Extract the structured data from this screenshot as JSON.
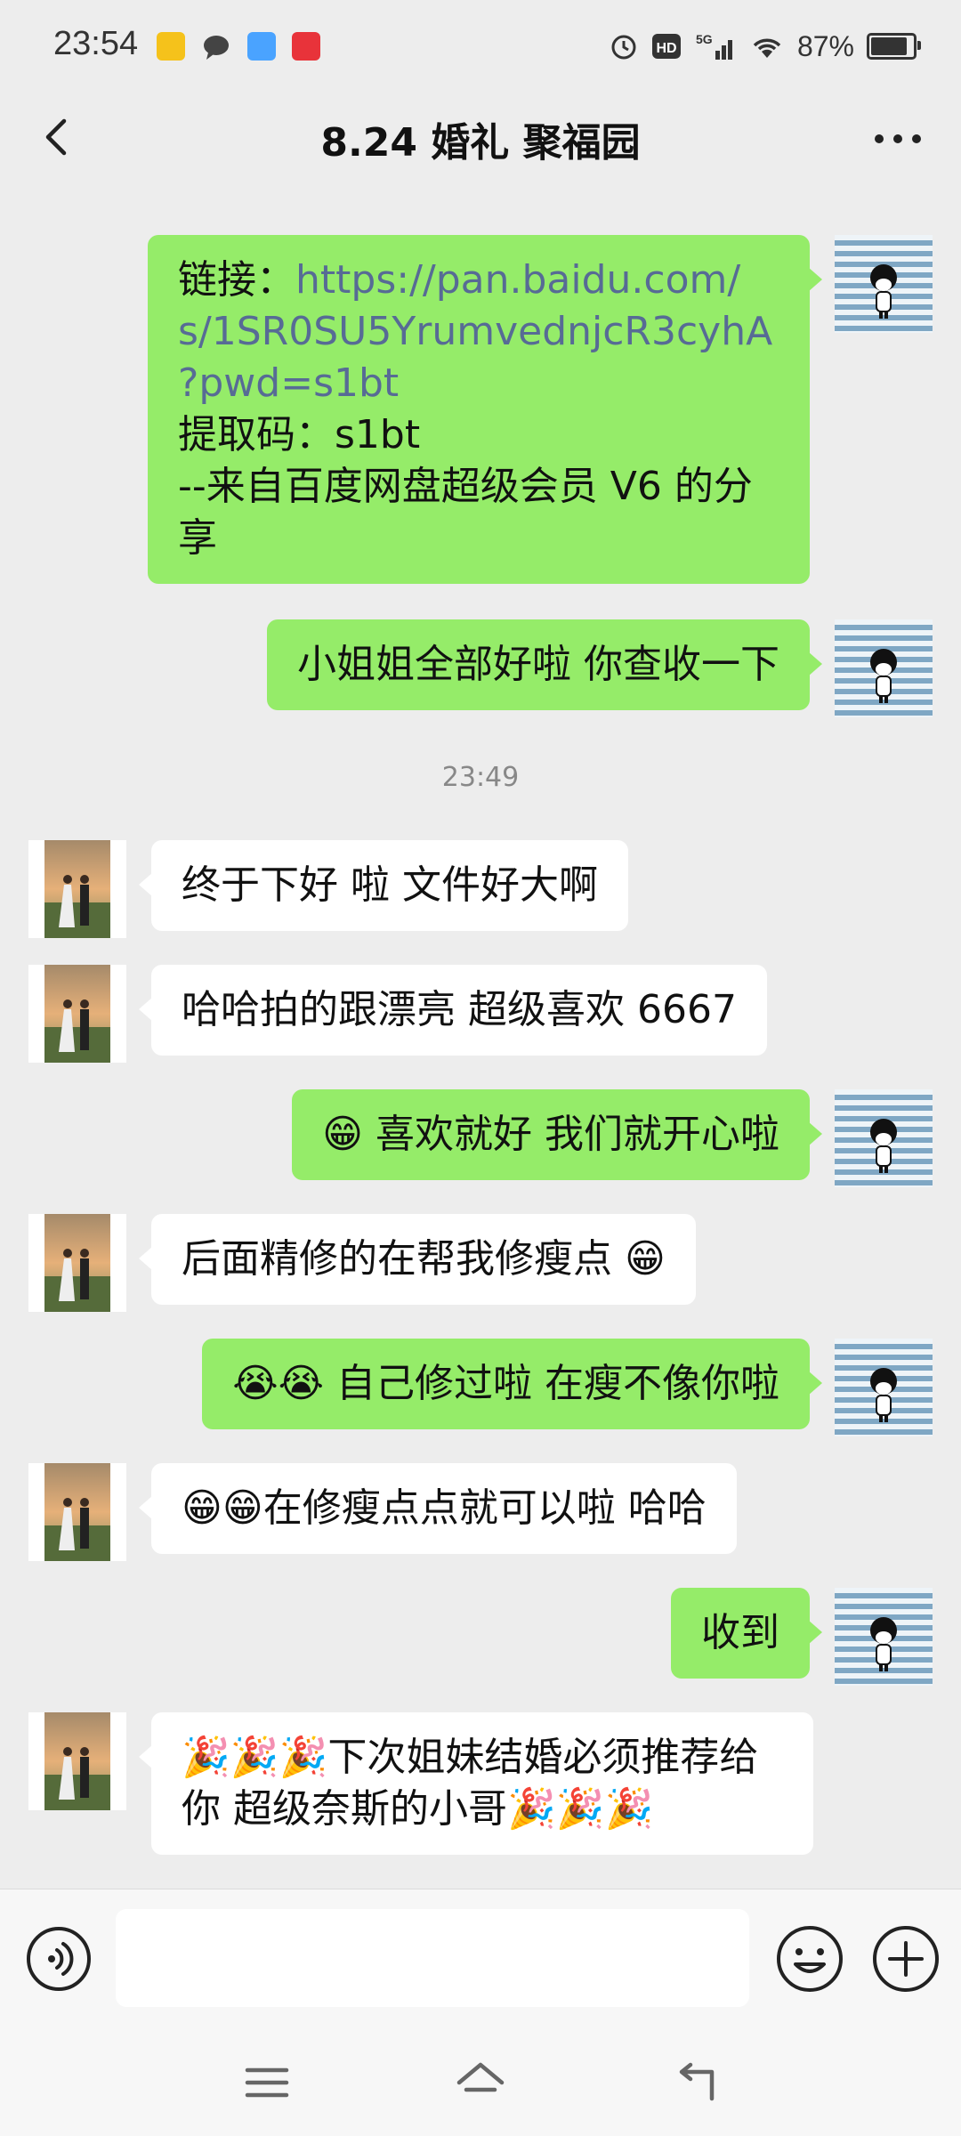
{
  "status_bar": {
    "time": "23:54",
    "battery_text": "87%",
    "battery_level_percent": 87,
    "app_icons": [
      "yellow-app-icon",
      "message-bubble-icon",
      "qq-icon",
      "red-app-icon"
    ],
    "right_icons": [
      "alarm-icon",
      "hd-icon",
      "5g-signal-icon",
      "wifi-icon",
      "battery-icon"
    ]
  },
  "header": {
    "title": "8.24 婚礼 聚福园"
  },
  "messages": [
    {
      "side": "right",
      "parts": [
        {
          "text": "链接：",
          "link": false
        },
        {
          "text": "https://pan.baidu.com/\ns/1SR0SU5YrumvednjcR3cyhA\n?pwd=s1bt",
          "link": true
        },
        {
          "text": "\n提取码：s1bt\n--来自百度网盘超级会员 V6 的分\n享",
          "link": false
        }
      ]
    },
    {
      "side": "right",
      "text": "小姐姐全部好啦 你查收一下"
    },
    {
      "time": "23:49"
    },
    {
      "side": "left",
      "text": "终于下好 啦 文件好大啊"
    },
    {
      "side": "left",
      "text": "哈哈拍的跟漂亮 超级喜欢 6667"
    },
    {
      "side": "right",
      "text": "😁 喜欢就好 我们就开心啦"
    },
    {
      "side": "left",
      "text": "后面精修的在帮我修瘦点 😁"
    },
    {
      "side": "right",
      "text": "😭😭 自己修过啦 在瘦不像你啦"
    },
    {
      "side": "left",
      "text": "😁😁在修瘦点点就可以啦 哈哈"
    },
    {
      "side": "right",
      "text": "收到"
    },
    {
      "side": "left",
      "text": "🎉🎉🎉下次姐妹结婚必须推荐给\n你 超级奈斯的小哥🎉🎉🎉"
    }
  ],
  "input": {
    "value": ""
  },
  "colors": {
    "background": "#ededed",
    "bubble_right": "#95ec69",
    "bubble_left": "#ffffff",
    "link": "#576b95",
    "time_divider": "#888888"
  }
}
